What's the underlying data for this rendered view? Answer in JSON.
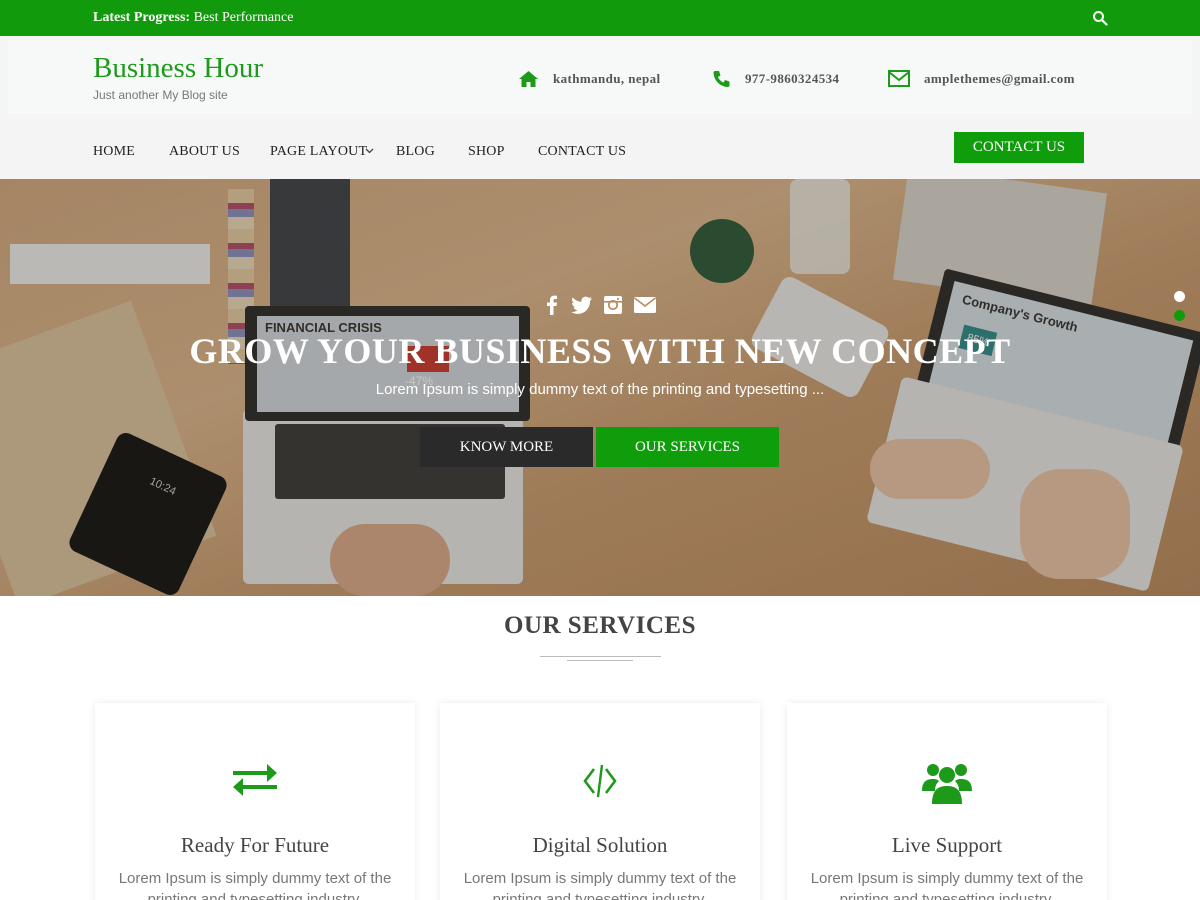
{
  "topbar": {
    "label": "Latest Progress:",
    "text": "Best Performance",
    "search_icon": "search-icon"
  },
  "header": {
    "site_title": "Business Hour",
    "tagline": "Just another My Blog site",
    "address": "kathmandu, nepal",
    "phone": "977-9860324534",
    "email": "amplethemes@gmail.com"
  },
  "nav": {
    "items": [
      {
        "label": "HOME"
      },
      {
        "label": "ABOUT US"
      },
      {
        "label": "PAGE LAYOUT"
      },
      {
        "label": "BLOG"
      },
      {
        "label": "SHOP"
      },
      {
        "label": "CONTACT US"
      }
    ],
    "cta_label": "CONTACT US"
  },
  "hero": {
    "title": "GROW YOUR BUSINESS WITH NEW CONCEPT",
    "subtitle": "Lorem Ipsum is simply dummy text of the printing and typesetting ...",
    "btn_primary": "KNOW MORE",
    "btn_secondary": "OUR SERVICES",
    "social_icons": [
      "facebook-icon",
      "twitter-icon",
      "instagram-icon",
      "envelope-icon"
    ],
    "photo_text": {
      "laptop_left_heading": "FINANCIAL CRISIS",
      "laptop_left_badge": "-47%",
      "laptop_right_heading": "Company's Growth",
      "laptop_right_badge": "85%",
      "phone_time": "10:24"
    },
    "slides": 2,
    "active_slide": 2
  },
  "services": {
    "title": "OUR SERVICES",
    "cards": [
      {
        "title": "Ready For Future",
        "text": "Lorem Ipsum is simply dummy text of the printing and typesetting industry.",
        "icon": "exchange-arrows-icon"
      },
      {
        "title": "Digital Solution",
        "text": "Lorem Ipsum is simply dummy text of the printing and typesetting industry.",
        "icon": "code-icon"
      },
      {
        "title": "Live Support",
        "text": "Lorem Ipsum is simply dummy text of the printing and typesetting industry.",
        "icon": "users-icon"
      }
    ]
  },
  "colors": {
    "brand_green": "#119b0c",
    "dark_button": "#2a2a2a"
  }
}
